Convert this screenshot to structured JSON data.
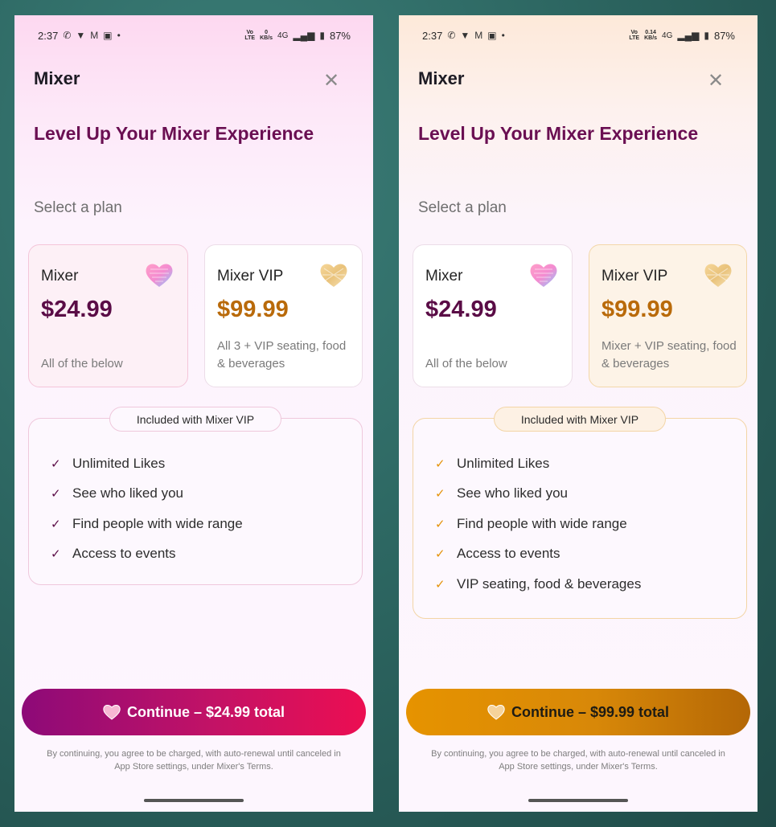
{
  "left": {
    "status": {
      "time": "2:37",
      "network_top": "0",
      "network_bottom": "KB/s",
      "signal": "4G",
      "battery": "87%"
    },
    "app_title": "Mixer",
    "headline": "Level Up Your Mixer Experience",
    "section_label": "Select a plan",
    "plans": [
      {
        "name": "Mixer",
        "price": "$24.99",
        "description": "All of the below"
      },
      {
        "name": "Mixer VIP",
        "price": "$99.99",
        "description": "All 3 + VIP seating, food & beverages"
      }
    ],
    "box_label": "Included with Mixer VIP",
    "features": [
      "Unlimited Likes",
      "See who liked you",
      "Find people with wide range",
      "Access to events"
    ],
    "cta_label": "Continue – $24.99 total",
    "legal": "By continuing, you agree to be charged, with auto-renewal until canceled in App Store settings, under Mixer's Terms.",
    "colors": {
      "accent": "#6a0f52",
      "cta_start": "#8d0a78",
      "cta_end": "#ec0e52"
    }
  },
  "right": {
    "status": {
      "time": "2:37",
      "network_top": "0.14",
      "network_bottom": "KB/s",
      "signal": "4G",
      "battery": "87%"
    },
    "app_title": "Mixer",
    "headline": "Level Up Your Mixer Experience",
    "section_label": "Select a plan",
    "plans": [
      {
        "name": "Mixer",
        "price": "$24.99",
        "description": "All of the below"
      },
      {
        "name": "Mixer VIP",
        "price": "$99.99",
        "description": "Mixer + VIP seating, food & beverages"
      }
    ],
    "box_label": "Included with Mixer VIP",
    "features": [
      "Unlimited Likes",
      "See who liked you",
      "Find people with wide range",
      "Access to events",
      "VIP seating, food & beverages"
    ],
    "cta_label": "Continue – $99.99 total",
    "legal": "By continuing, you agree to be charged, with auto-renewal until canceled in App Store settings, under Mixer's Terms.",
    "colors": {
      "accent": "#e4930a",
      "cta_start": "#e69300",
      "cta_end": "#b46706"
    }
  },
  "icons": {
    "close": "close-icon",
    "check": "check-icon",
    "heart_basic": "pink-heart-icon",
    "heart_vip": "gold-heart-icon",
    "status": [
      "whatsapp-icon",
      "vpn-icon",
      "gmail-icon",
      "cast-icon",
      "signal-icon",
      "battery-icon"
    ]
  }
}
